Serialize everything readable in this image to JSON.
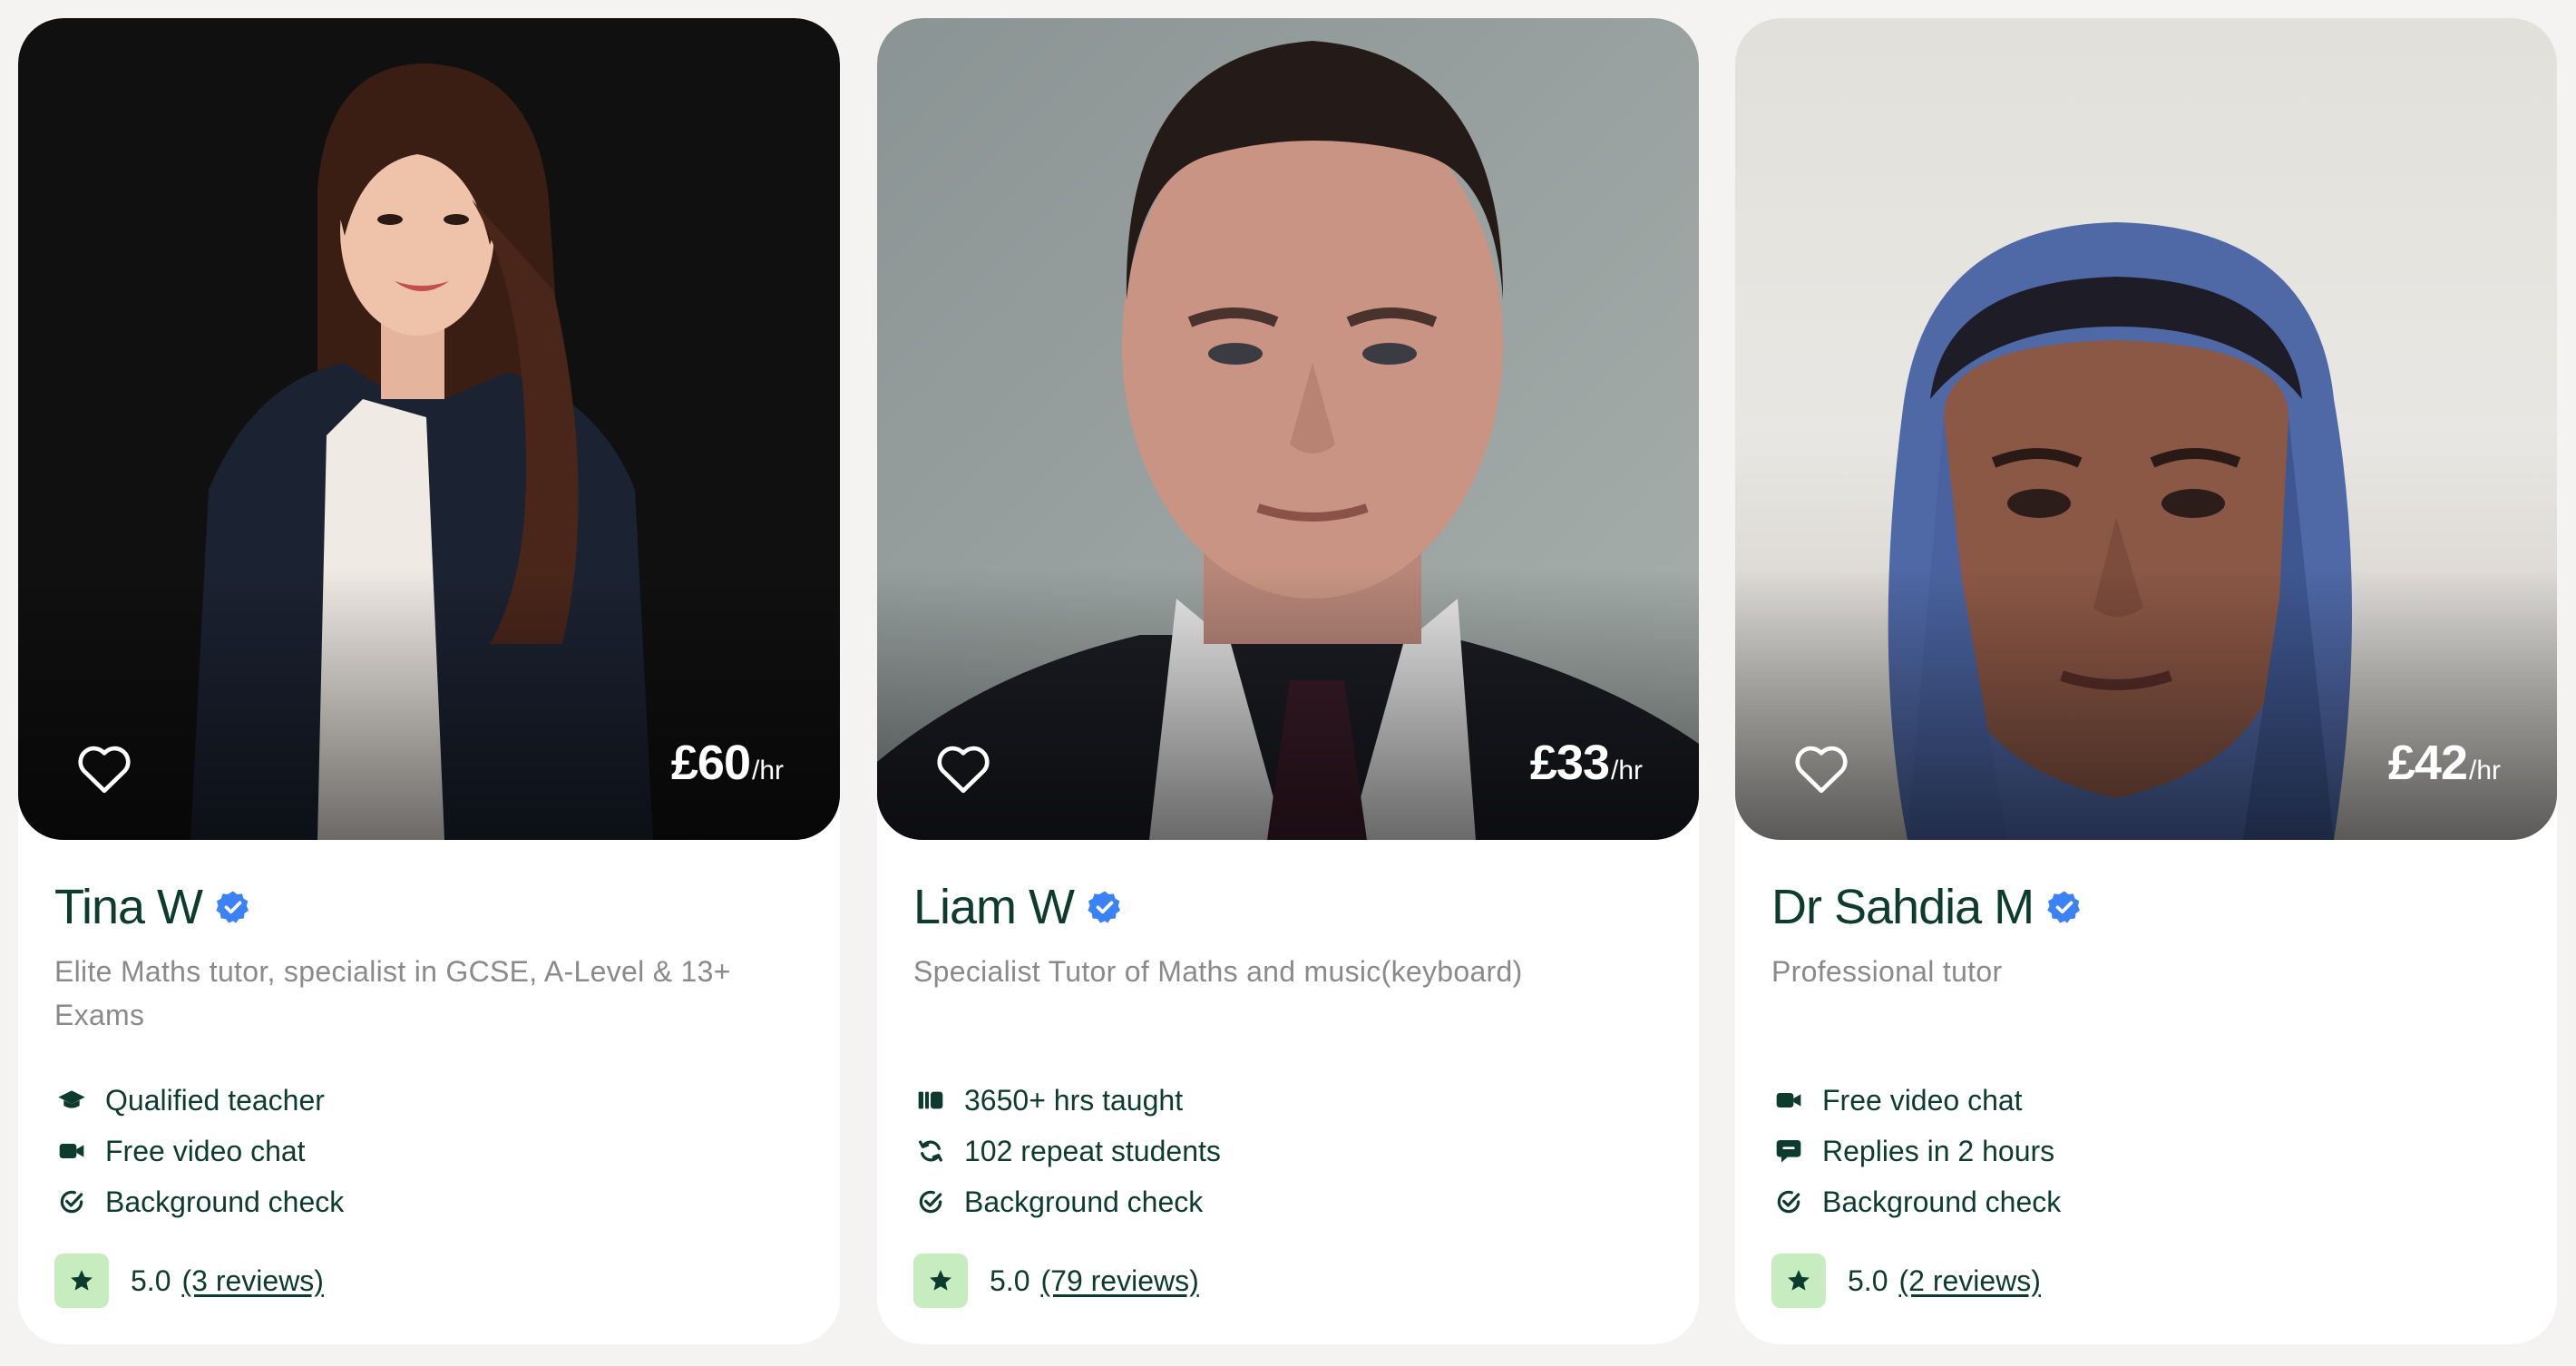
{
  "tutors": [
    {
      "name": "Tina W",
      "price": "£60",
      "price_unit": "/hr",
      "tagline": "Elite Maths tutor, specialist in GCSE, A-Level & 13+ Exams",
      "features": [
        {
          "icon": "graduation-cap-icon",
          "label": "Qualified teacher"
        },
        {
          "icon": "video-camera-icon",
          "label": "Free video chat"
        },
        {
          "icon": "check-badge-icon",
          "label": "Background check"
        }
      ],
      "score": "5.0",
      "reviews": "(3 reviews)"
    },
    {
      "name": "Liam W",
      "price": "£33",
      "price_unit": "/hr",
      "tagline": "Specialist Tutor of Maths and music(keyboard)",
      "features": [
        {
          "icon": "hours-taught-icon",
          "label": "3650+ hrs taught"
        },
        {
          "icon": "repeat-icon",
          "label": "102 repeat students"
        },
        {
          "icon": "check-badge-icon",
          "label": "Background check"
        }
      ],
      "score": "5.0",
      "reviews": "(79 reviews)"
    },
    {
      "name": "Dr Sahdia M",
      "price": "£42",
      "price_unit": "/hr",
      "tagline": "Professional tutor",
      "features": [
        {
          "icon": "video-camera-icon",
          "label": "Free video chat"
        },
        {
          "icon": "chat-bubble-icon",
          "label": "Replies in 2 hours"
        },
        {
          "icon": "check-badge-icon",
          "label": "Background check"
        }
      ],
      "score": "5.0",
      "reviews": "(2 reviews)"
    }
  ],
  "colors": {
    "page_bg": "#f5f3f1",
    "card_bg": "#ffffff",
    "text_dark": "#0d3b2e",
    "text_muted": "#8a8a8a",
    "verified_blue": "#3b82f6",
    "star_bg": "#c6ecc0"
  }
}
